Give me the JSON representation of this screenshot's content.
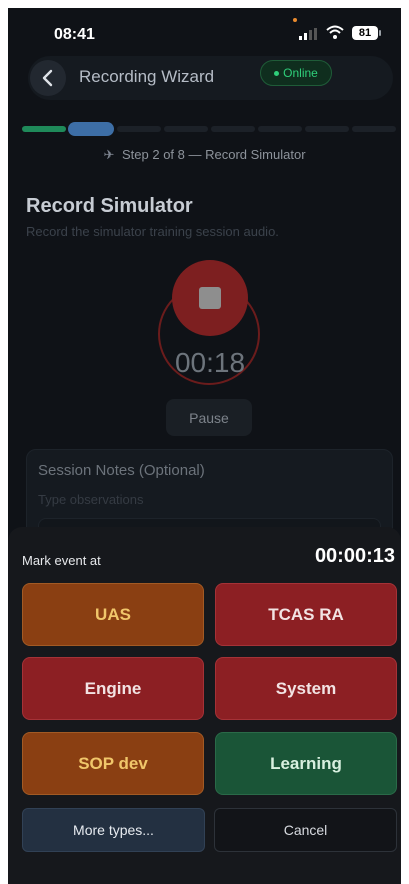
{
  "status_bar": {
    "time": "08:41",
    "battery": "81"
  },
  "header": {
    "title": "Recording Wizard",
    "status": "Online"
  },
  "stepper": {
    "current": 2,
    "total": 8,
    "label": "Step 2 of 8 — Record Simulator"
  },
  "page": {
    "title": "Record Simulator",
    "subtitle": "Record the simulator training session audio."
  },
  "recorder": {
    "elapsed": "00:18",
    "pause_label": "Pause"
  },
  "notes": {
    "title": "Session Notes (Optional)",
    "placeholder": "Type observations"
  },
  "sheet": {
    "mark_label": "Mark event at",
    "mark_time": "00:00:13",
    "events": [
      {
        "label": "UAS",
        "color": "orange"
      },
      {
        "label": "TCAS RA",
        "color": "red"
      },
      {
        "label": "Engine",
        "color": "red"
      },
      {
        "label": "System",
        "color": "red"
      },
      {
        "label": "SOP dev",
        "color": "orange"
      },
      {
        "label": "Learning",
        "color": "green"
      }
    ],
    "more_label": "More types...",
    "cancel_label": "Cancel"
  },
  "colors": {
    "recording_red": "#7d1f20",
    "online_green": "#2fcf7a",
    "event_orange": "#8a3f12",
    "event_red": "#8c1f23",
    "event_green": "#1a5537"
  },
  "icons": [
    "back-chevron-icon",
    "airplane-icon",
    "stop-icon",
    "signal-icon",
    "wifi-icon",
    "battery-icon"
  ]
}
